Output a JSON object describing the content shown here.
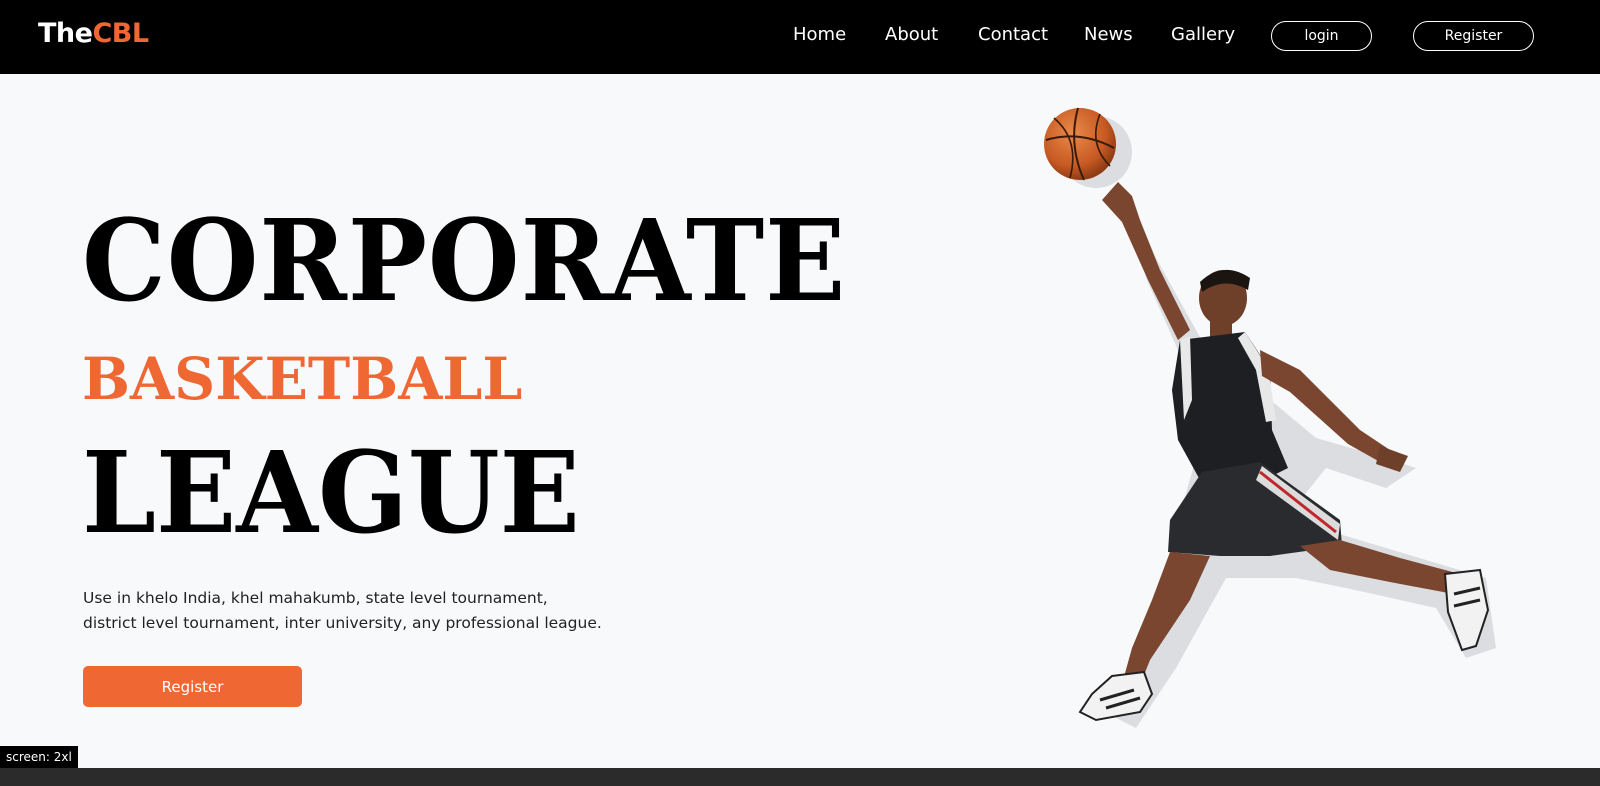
{
  "brand": {
    "logo_prefix": "The",
    "logo_accent": "CBL",
    "accent_color": "#ef6732"
  },
  "nav": {
    "links": [
      "Home",
      "About",
      "Contact",
      "News",
      "Gallery"
    ],
    "login_label": "login",
    "register_label": "Register"
  },
  "hero": {
    "line1": "CORPORATE",
    "line2": "BASKETBALL",
    "line3": "LEAGUE",
    "description": "Use in khelo India, khel mahakumb, state level tournament, district level tournament, inter university, any professional league.",
    "cta_label": "Register",
    "image": "basketball-player-dunk"
  },
  "debug": {
    "screen_label": "screen: 2xl"
  }
}
